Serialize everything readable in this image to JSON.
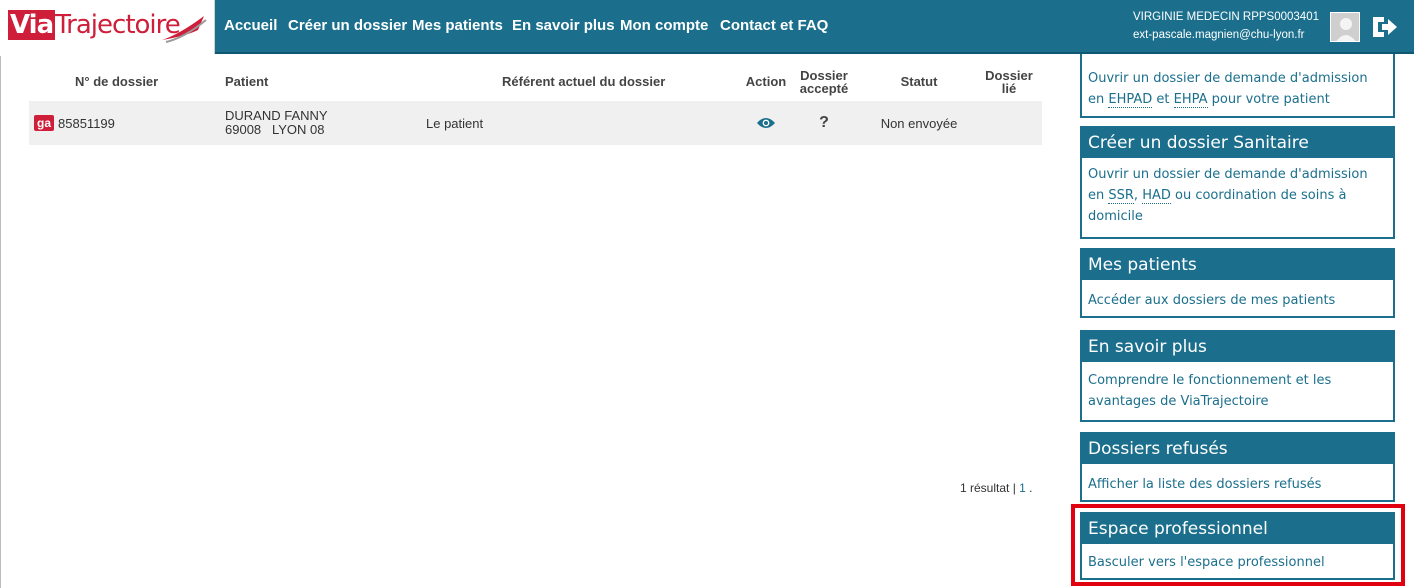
{
  "logo": {
    "via": "Via",
    "rest": "Trajectoire"
  },
  "nav": [
    {
      "id": "accueil",
      "label": "Accueil"
    },
    {
      "id": "creer",
      "label": "Créer un dossier"
    },
    {
      "id": "mes-patients",
      "label": "Mes patients"
    },
    {
      "id": "savoir",
      "label": "En savoir plus"
    },
    {
      "id": "compte",
      "label": "Mon compte"
    },
    {
      "id": "contact",
      "label": "Contact et FAQ"
    }
  ],
  "user": {
    "name": "VIRGINIE MEDECIN RPPS0003401",
    "email": "ext-pascale.magnien@chu-lyon.fr"
  },
  "table": {
    "headers": {
      "dossier": "N° de dossier",
      "patient": "Patient",
      "referent": "Référent actuel du dossier",
      "action": "Action",
      "accepte_line1": "Dossier",
      "accepte_line2": "accepté",
      "statut": "Statut",
      "lie_line1": "Dossier",
      "lie_line2": "lié"
    },
    "rows": [
      {
        "badge": "ga",
        "dossier": "85851199",
        "patient_name": "DURAND FANNY",
        "patient_address": "69008   LYON 08",
        "referent": "Le patient",
        "accepte": "?",
        "statut": "Non envoyée",
        "lie": ""
      }
    ]
  },
  "pagination": {
    "summary": "1 résultat | ",
    "page": "1",
    "suffix": " ."
  },
  "panels": {
    "medico_social": {
      "body_part1": "Ouvrir un dossier de demande d'admission en ",
      "abbr1": "EHPAD",
      "body_part2": " et ",
      "abbr2": "EHPA",
      "body_part3": " pour votre patient"
    },
    "sanitaire": {
      "title": "Créer un dossier Sanitaire",
      "body_part1": "Ouvrir un dossier de demande d'admission en ",
      "abbr1": "SSR",
      "body_part2": ", ",
      "abbr2": "HAD",
      "body_part3": " ou coordination de soins à domicile"
    },
    "mes_patients": {
      "title": "Mes patients",
      "body": "Accéder aux dossiers de mes patients"
    },
    "savoir": {
      "title": "En savoir plus",
      "body": "Comprendre le fonctionnement et les avantages de ViaTrajectoire"
    },
    "refuses": {
      "title": "Dossiers refusés",
      "body": "Afficher la liste des dossiers refusés"
    },
    "pro": {
      "title": "Espace professionnel",
      "body": "Basculer vers l'espace professionnel"
    }
  },
  "colors": {
    "primary": "#1b6f8d",
    "brand_red": "#cf1e39",
    "highlight": "#e0000f"
  }
}
